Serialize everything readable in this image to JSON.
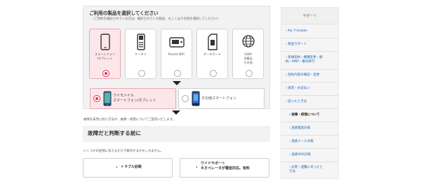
{
  "main": {
    "select_title": "ご利用の製品を選択してください",
    "select_sub": "（ご契約を検討されている方は、検討されている製品、もしくはその他を選択してください）",
    "devices": [
      {
        "label": "スマートフォン\n/タブレット",
        "icon": "smartphone-icon",
        "selected": true
      },
      {
        "label": "ケータイ",
        "icon": "feature-phone-icon",
        "selected": false
      },
      {
        "label": "Pocket WiFi",
        "icon": "pocket-wifi-icon",
        "selected": false
      },
      {
        "label": "データカード",
        "icon": "data-card-icon",
        "selected": false
      },
      {
        "label": "USIM\n付属品\nその他",
        "icon": "globe-icon",
        "selected": false
      }
    ],
    "sub_options": [
      {
        "label": "ワイモバイル\nスマートフォン/タブレット",
        "selected": true
      },
      {
        "label": "その他スマートフォン",
        "selected": false
      }
    ],
    "note": "故障を未然に防ぐ方法や、故障・修理についてご案内いたします。",
    "heading": "故障だと判断する前に",
    "intro": "いくつかの症例に答えるだけで解決するかもしれません。",
    "buttons": [
      {
        "label": "トラブル診断"
      },
      {
        "label": "ワイドサポート\n※オペレータが電話対応。有料"
      }
    ]
  },
  "sidebar": {
    "title": "サポート",
    "items": [
      {
        "label": "My Y!mobile"
      },
      {
        "label": "製品サポート"
      },
      {
        "label": "新規契約・機種変更・解\n約・MNP・番号移行"
      },
      {
        "label": "契約内容の確認・変更"
      },
      {
        "label": "請求・お支払い"
      },
      {
        "label": "困ったときは"
      },
      {
        "label": "故障・修理について"
      },
      {
        "label": "迷惑電話対策"
      },
      {
        "label": "迷惑メール対策"
      },
      {
        "label": "迷惑SMS対策"
      },
      {
        "label": "お客・盗難にあったと\nきは"
      }
    ]
  },
  "colors": {
    "accent": "#d9354f",
    "link": "#1a66b8",
    "selected_bg": "#fde6ea"
  }
}
